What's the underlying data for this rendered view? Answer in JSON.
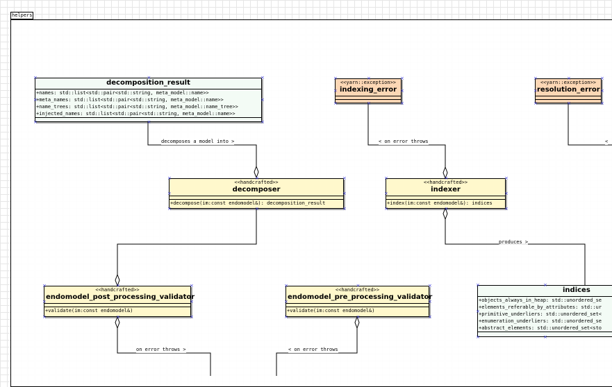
{
  "package": {
    "name": "helpers"
  },
  "classes": {
    "decomposition_result": {
      "name": "decomposition_result",
      "attributes": [
        "+names: std::list<std::pair<std::string, meta_model::name>>",
        "+meta_names: std::list<std::pair<std::string, meta_model::name>>",
        "+name_trees: std::list<std::pair<std::string, meta_model::name_tree>>",
        "+injected_names: std::list<std::pair<std::string, meta_model::name>>"
      ]
    },
    "indexing_error": {
      "stereotype": "<<yarn::exception>>",
      "name": "indexing_error"
    },
    "resolution_error": {
      "stereotype": "<<yarn::exception>>",
      "name": "resolution_error"
    },
    "decomposer": {
      "stereotype": "<<handcrafted>>",
      "name": "decomposer",
      "operations": [
        "+decompose(im:const endomodel&): decomposition_result"
      ]
    },
    "indexer": {
      "stereotype": "<<handcrafted>>",
      "name": "indexer",
      "operations": [
        "+index(im:const endomodel&): indices"
      ]
    },
    "post_validator": {
      "stereotype": "<<handcrafted>>",
      "name": "endomodel_post_processing_validator",
      "operations": [
        "+validate(im:const endomodel&)"
      ]
    },
    "pre_validator": {
      "stereotype": "<<handcrafted>>",
      "name": "endomodel_pre_processing_validator",
      "operations": [
        "+validate(im:const endomodel&)"
      ]
    },
    "indices": {
      "name": "indices",
      "attributes": [
        "+objects_always_in_heap: std::unordered_se",
        "+elements_referable_by_attributes: std::ur",
        "+primitive_underliers: std::unordered_set<",
        "+enumeration_underliers: std::unordered_se",
        "+abstract_elements: std::unordered_set<sto"
      ]
    }
  },
  "edges": {
    "decomposes": "decomposes a model into >",
    "indexer_throws": "< on error throws",
    "resolution_throws": "<",
    "produces": "produces >",
    "post_throws": "on error throws >",
    "pre_throws": "< on error throws"
  },
  "colors": {
    "handcrafted": "#fff8cc",
    "exception": "#fcd7b5",
    "value": "#f3fbf5",
    "handle": "#3a3adc"
  }
}
